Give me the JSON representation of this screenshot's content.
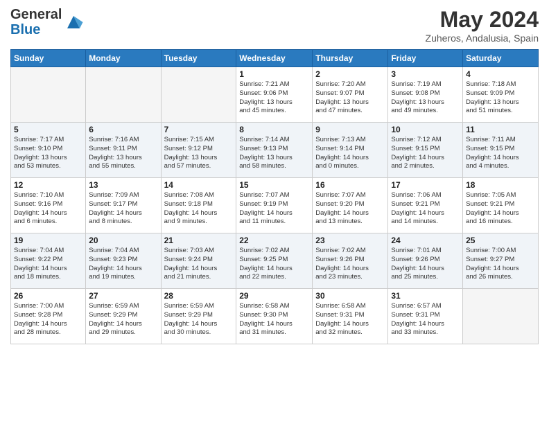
{
  "header": {
    "logo_line1": "General",
    "logo_line2": "Blue",
    "month_title": "May 2024",
    "location": "Zuheros, Andalusia, Spain"
  },
  "days_of_week": [
    "Sunday",
    "Monday",
    "Tuesday",
    "Wednesday",
    "Thursday",
    "Friday",
    "Saturday"
  ],
  "weeks": [
    [
      {
        "day": "",
        "info": ""
      },
      {
        "day": "",
        "info": ""
      },
      {
        "day": "",
        "info": ""
      },
      {
        "day": "1",
        "info": "Sunrise: 7:21 AM\nSunset: 9:06 PM\nDaylight: 13 hours\nand 45 minutes."
      },
      {
        "day": "2",
        "info": "Sunrise: 7:20 AM\nSunset: 9:07 PM\nDaylight: 13 hours\nand 47 minutes."
      },
      {
        "day": "3",
        "info": "Sunrise: 7:19 AM\nSunset: 9:08 PM\nDaylight: 13 hours\nand 49 minutes."
      },
      {
        "day": "4",
        "info": "Sunrise: 7:18 AM\nSunset: 9:09 PM\nDaylight: 13 hours\nand 51 minutes."
      }
    ],
    [
      {
        "day": "5",
        "info": "Sunrise: 7:17 AM\nSunset: 9:10 PM\nDaylight: 13 hours\nand 53 minutes."
      },
      {
        "day": "6",
        "info": "Sunrise: 7:16 AM\nSunset: 9:11 PM\nDaylight: 13 hours\nand 55 minutes."
      },
      {
        "day": "7",
        "info": "Sunrise: 7:15 AM\nSunset: 9:12 PM\nDaylight: 13 hours\nand 57 minutes."
      },
      {
        "day": "8",
        "info": "Sunrise: 7:14 AM\nSunset: 9:13 PM\nDaylight: 13 hours\nand 58 minutes."
      },
      {
        "day": "9",
        "info": "Sunrise: 7:13 AM\nSunset: 9:14 PM\nDaylight: 14 hours\nand 0 minutes."
      },
      {
        "day": "10",
        "info": "Sunrise: 7:12 AM\nSunset: 9:15 PM\nDaylight: 14 hours\nand 2 minutes."
      },
      {
        "day": "11",
        "info": "Sunrise: 7:11 AM\nSunset: 9:15 PM\nDaylight: 14 hours\nand 4 minutes."
      }
    ],
    [
      {
        "day": "12",
        "info": "Sunrise: 7:10 AM\nSunset: 9:16 PM\nDaylight: 14 hours\nand 6 minutes."
      },
      {
        "day": "13",
        "info": "Sunrise: 7:09 AM\nSunset: 9:17 PM\nDaylight: 14 hours\nand 8 minutes."
      },
      {
        "day": "14",
        "info": "Sunrise: 7:08 AM\nSunset: 9:18 PM\nDaylight: 14 hours\nand 9 minutes."
      },
      {
        "day": "15",
        "info": "Sunrise: 7:07 AM\nSunset: 9:19 PM\nDaylight: 14 hours\nand 11 minutes."
      },
      {
        "day": "16",
        "info": "Sunrise: 7:07 AM\nSunset: 9:20 PM\nDaylight: 14 hours\nand 13 minutes."
      },
      {
        "day": "17",
        "info": "Sunrise: 7:06 AM\nSunset: 9:21 PM\nDaylight: 14 hours\nand 14 minutes."
      },
      {
        "day": "18",
        "info": "Sunrise: 7:05 AM\nSunset: 9:21 PM\nDaylight: 14 hours\nand 16 minutes."
      }
    ],
    [
      {
        "day": "19",
        "info": "Sunrise: 7:04 AM\nSunset: 9:22 PM\nDaylight: 14 hours\nand 18 minutes."
      },
      {
        "day": "20",
        "info": "Sunrise: 7:04 AM\nSunset: 9:23 PM\nDaylight: 14 hours\nand 19 minutes."
      },
      {
        "day": "21",
        "info": "Sunrise: 7:03 AM\nSunset: 9:24 PM\nDaylight: 14 hours\nand 21 minutes."
      },
      {
        "day": "22",
        "info": "Sunrise: 7:02 AM\nSunset: 9:25 PM\nDaylight: 14 hours\nand 22 minutes."
      },
      {
        "day": "23",
        "info": "Sunrise: 7:02 AM\nSunset: 9:26 PM\nDaylight: 14 hours\nand 23 minutes."
      },
      {
        "day": "24",
        "info": "Sunrise: 7:01 AM\nSunset: 9:26 PM\nDaylight: 14 hours\nand 25 minutes."
      },
      {
        "day": "25",
        "info": "Sunrise: 7:00 AM\nSunset: 9:27 PM\nDaylight: 14 hours\nand 26 minutes."
      }
    ],
    [
      {
        "day": "26",
        "info": "Sunrise: 7:00 AM\nSunset: 9:28 PM\nDaylight: 14 hours\nand 28 minutes."
      },
      {
        "day": "27",
        "info": "Sunrise: 6:59 AM\nSunset: 9:29 PM\nDaylight: 14 hours\nand 29 minutes."
      },
      {
        "day": "28",
        "info": "Sunrise: 6:59 AM\nSunset: 9:29 PM\nDaylight: 14 hours\nand 30 minutes."
      },
      {
        "day": "29",
        "info": "Sunrise: 6:58 AM\nSunset: 9:30 PM\nDaylight: 14 hours\nand 31 minutes."
      },
      {
        "day": "30",
        "info": "Sunrise: 6:58 AM\nSunset: 9:31 PM\nDaylight: 14 hours\nand 32 minutes."
      },
      {
        "day": "31",
        "info": "Sunrise: 6:57 AM\nSunset: 9:31 PM\nDaylight: 14 hours\nand 33 minutes."
      },
      {
        "day": "",
        "info": ""
      }
    ]
  ]
}
